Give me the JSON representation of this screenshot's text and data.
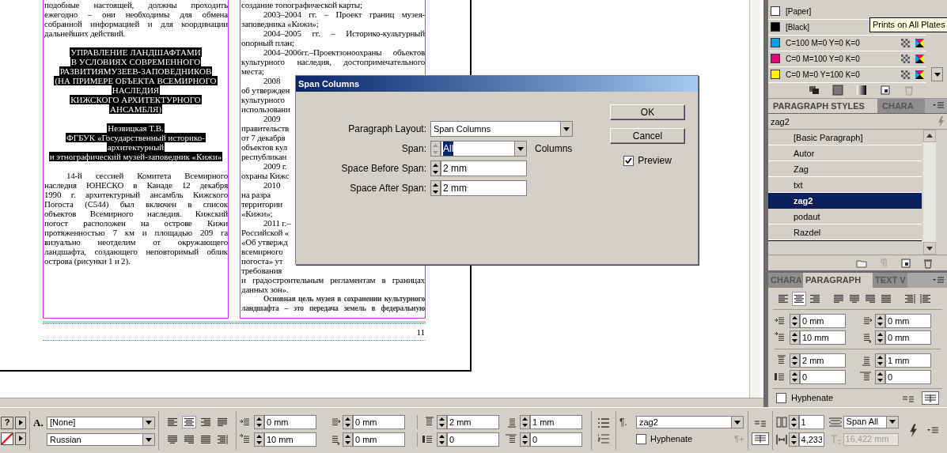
{
  "document": {
    "left_column": [
      {
        "kind": "paragraph",
        "indent": false,
        "lines": [
          "подобные настоящей, должны проходить",
          "ежегодно – они необходимы для обмена",
          "собранной информацией и для координации",
          "дальнейших действий."
        ]
      },
      {
        "kind": "heading",
        "lines": [
          "УПРАВЛЕНИЕ ЛАНДШАФТАМИ",
          "В УСЛОВИЯХ СОВРЕМЕННОГО",
          "РАЗВИТИЯМУЗЕЕВ-ЗАПОВЕДНИКОВ",
          "(НА ПРИМЕРЕ ОБЪЕКТА ВСЕМИРНОГО",
          "НАСЛЕДИЯ",
          "КИЖСКОГО АРХИТЕКТУРНОГО",
          "АНСАМБЛЯ)"
        ]
      },
      {
        "kind": "heading",
        "lines": [
          "Незвицкая Т.В.",
          "ФГБУК «Государственный историко-",
          "архитектурный",
          "и этнографический музей-заповедник «Кижи»"
        ]
      },
      {
        "kind": "paragraph",
        "indent": true,
        "lines": [
          "14-й сессией Комитета Всемирного",
          "наследия ЮНЕСКО в Канаде 12 декабря",
          "1990 г. архитектурный ансамбль Кижского",
          "Погоста (С544) был включен в список",
          "объектов Всемирного наследия. Кижский",
          "погост расположен на острове Кижи",
          "протяженностью 7 км и площадью 209 га",
          "визуально неотделим от окружающего",
          "ландшафта, создающего неповторимый облик",
          "острова (рисунки 1 и 2)."
        ]
      }
    ],
    "right_column": [
      {
        "kind": "paragraph",
        "indent": false,
        "lines": [
          "создание топографической карты;"
        ]
      },
      {
        "kind": "paragraph",
        "indent": true,
        "lines": [
          "2003–2004 гг. – Проект границ музея-",
          "заповедника «Кижи»;"
        ]
      },
      {
        "kind": "paragraph",
        "indent": true,
        "lines": [
          "2004–2005 гг. – Историко-культурный",
          "опорный план;"
        ]
      },
      {
        "kind": "paragraph",
        "indent": true,
        "lines": [
          "2004–2006гг.–Проектзоноохраны объектов",
          "культурного наследия, достопримечательного",
          "места;"
        ]
      },
      {
        "kind": "fragment",
        "indent": true,
        "lines": [
          "2008",
          "об утвержден",
          "культурного",
          "использовани"
        ]
      },
      {
        "kind": "fragment",
        "indent": true,
        "lines": [
          "2009",
          "правительств",
          "от 7 декабря",
          "объектов кул",
          "республикан"
        ]
      },
      {
        "kind": "fragment",
        "indent": true,
        "lines": [
          "2009 г.",
          "охраны Кижс"
        ]
      },
      {
        "kind": "fragment",
        "indent": true,
        "lines": [
          "2010",
          "на разра",
          "территории",
          "«Кижи»;"
        ]
      },
      {
        "kind": "fragment",
        "indent": true,
        "lines": [
          "2011 г.–",
          "Российской «",
          "«Об утвержд",
          "всемирного",
          "погоста» ут",
          "требования"
        ]
      },
      {
        "kind": "paragraph",
        "indent": false,
        "lines": [
          "и градостроительным регламентам в границах",
          "данных зон»."
        ]
      },
      {
        "kind": "small",
        "indent": true,
        "lines": [
          "Основная цель музея в сохранении культурного",
          "ландшафта – это передача земель в федеральную"
        ]
      }
    ],
    "page_number": "11"
  },
  "dialog": {
    "title": "Span Columns",
    "fields": [
      {
        "kind": "dropdown",
        "label": "Paragraph Layout:",
        "value": "Span Columns"
      },
      {
        "kind": "spin-dropdown",
        "label": "Span:",
        "value": "All",
        "value_selected": true,
        "unit": "Columns"
      },
      {
        "kind": "spin",
        "label": "Space Before Span:",
        "value": "2 mm"
      },
      {
        "kind": "spin",
        "label": "Space After Span:",
        "value": "2 mm"
      }
    ],
    "buttons": [
      "OK",
      "Cancel"
    ],
    "preview": {
      "label": "Preview",
      "checked": true
    }
  },
  "swatches": {
    "items": [
      {
        "name": "[Paper]",
        "color": "#ffffff",
        "process": false
      },
      {
        "name": "[Black]",
        "color": "#000000"
      },
      {
        "name": "C=100 M=0 Y=0 K=0",
        "color": "#00a0e9",
        "process": true
      },
      {
        "name": "C=0 M=100 Y=0 K=0",
        "color": "#e4007f",
        "process": true
      },
      {
        "name": "C=0 M=0 Y=100 K=0",
        "color": "#fff100",
        "process": true
      }
    ],
    "tooltip": "Prints on All Plates"
  },
  "paragraph_styles": {
    "tabs": [
      {
        "label": "PARAGRAPH STYLES",
        "selected": true
      },
      {
        "label": "CHARA",
        "selected": false
      }
    ],
    "current": "zag2",
    "items": [
      {
        "label": "[Basic Paragraph]",
        "selected": false
      },
      {
        "label": "Autor",
        "selected": false
      },
      {
        "label": "Zag",
        "selected": false
      },
      {
        "label": "txt",
        "selected": false
      },
      {
        "label": "zag2",
        "selected": true
      },
      {
        "label": "podaut",
        "selected": false
      },
      {
        "label": "Razdel",
        "selected": false
      }
    ]
  },
  "paragraph_panel": {
    "tabs": [
      {
        "label": "CHARA",
        "selected": false
      },
      {
        "label": "PARAGRAPH",
        "selected": true
      },
      {
        "label": "TEXT V",
        "selected": false
      }
    ],
    "alignment": [
      {
        "kind": "left",
        "selected": false
      },
      {
        "kind": "center",
        "selected": true
      },
      {
        "kind": "right",
        "selected": false
      },
      {
        "kind": "justify-left",
        "selected": false
      },
      {
        "kind": "justify-center",
        "selected": false
      },
      {
        "kind": "justify-right",
        "selected": false
      },
      {
        "kind": "justify-all",
        "selected": false
      },
      {
        "kind": "toward-spine",
        "selected": false
      },
      {
        "kind": "away-spine",
        "selected": false
      }
    ],
    "fields": [
      {
        "kind": "left-indent",
        "value": "0 mm"
      },
      {
        "kind": "right-indent",
        "value": "0 mm"
      },
      {
        "kind": "first-line-indent",
        "value": "10 mm"
      },
      {
        "kind": "last-line-indent",
        "value": "0 mm"
      },
      {
        "kind": "space-before",
        "value": "2 mm"
      },
      {
        "kind": "space-after",
        "value": "1 mm"
      },
      {
        "kind": "drop-cap-lines",
        "value": "0"
      },
      {
        "kind": "drop-cap-chars",
        "value": "0"
      }
    ],
    "hyphenate": {
      "label": "Hyphenate",
      "checked": false
    },
    "span_buttons": [
      {
        "kind": "single",
        "selected": false
      },
      {
        "kind": "all",
        "selected": true
      }
    ]
  },
  "control_panel": {
    "help": "?",
    "char_icon": "A.",
    "char_style": "[None]",
    "language": "Russian",
    "alignment": [
      {
        "kind": "left",
        "selected": false
      },
      {
        "kind": "center",
        "selected": true
      },
      {
        "kind": "right",
        "selected": false
      },
      {
        "kind": "justify-left",
        "selected": false
      },
      {
        "kind": "justify-center",
        "selected": false
      },
      {
        "kind": "justify-right",
        "selected": false
      },
      {
        "kind": "justify-all",
        "selected": false
      },
      {
        "kind": "toward-spine",
        "selected": false
      }
    ],
    "fields": [
      {
        "kind": "left-indent",
        "value": "0 mm"
      },
      {
        "kind": "right-indent",
        "value": "0 mm"
      },
      {
        "kind": "space-before",
        "value": "2 mm"
      },
      {
        "kind": "space-after",
        "value": "1 mm"
      },
      {
        "kind": "first-line-indent",
        "value": "10 mm"
      },
      {
        "kind": "last-line-indent",
        "value": "0 mm"
      },
      {
        "kind": "drop-cap-lines",
        "value": "0"
      },
      {
        "kind": "drop-cap-chars",
        "value": "0"
      }
    ],
    "pilcrow": "¶.",
    "paragraph_style": "zag2",
    "hyphenate": {
      "label": "Hyphenate",
      "checked": false
    },
    "new_style": "¶+",
    "columns": "1",
    "gutter": "4,233",
    "span": "Span All",
    "span_width": {
      "value": "16,422 mm",
      "disabled": true
    }
  }
}
